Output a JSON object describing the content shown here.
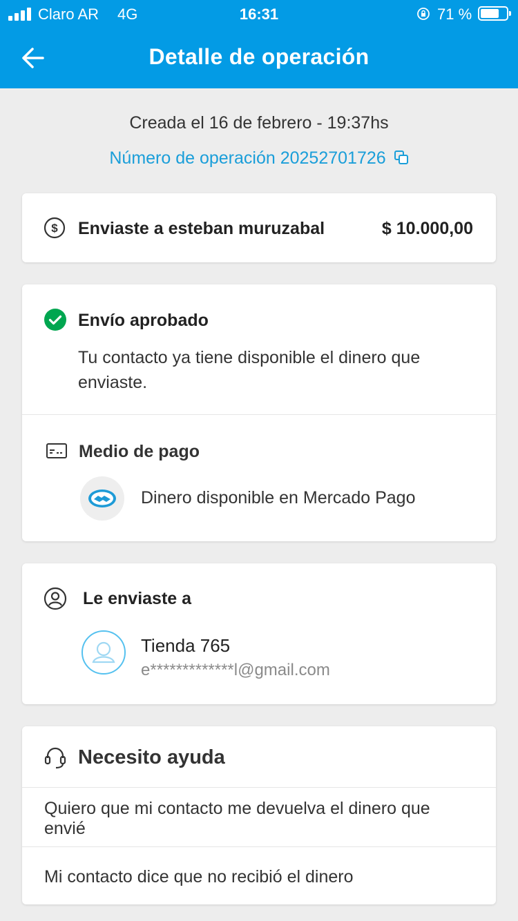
{
  "status_bar": {
    "carrier": "Claro AR",
    "network": "4G",
    "time": "16:31",
    "battery_percent": "71 %",
    "battery_level": 0.71
  },
  "header": {
    "title": "Detalle de operación",
    "back_icon": "arrow-left-icon"
  },
  "operation": {
    "created": "Creada el 16 de febrero - 19:37hs",
    "number": "Número de operación 20252701726"
  },
  "summary": {
    "label": "Enviaste a esteban muruzabal",
    "amount": "$ 10.000,00"
  },
  "status": {
    "title": "Envío aprobado",
    "description": "Tu contacto ya tiene disponible el dinero que enviaste."
  },
  "payment": {
    "title": "Medio de pago",
    "method": "Dinero disponible en Mercado Pago"
  },
  "recipient": {
    "title": "Le enviaste a",
    "name": "Tienda 765",
    "email": "e*************l@gmail.com"
  },
  "help": {
    "title": "Necesito ayuda",
    "items": [
      "Quiero que mi contacto me devuelva el dinero que envié",
      "Mi contacto dice que no recibió el dinero"
    ]
  },
  "colors": {
    "primary": "#039be5",
    "link": "#1a9ed9",
    "success": "#00a650",
    "background": "#ededed"
  }
}
